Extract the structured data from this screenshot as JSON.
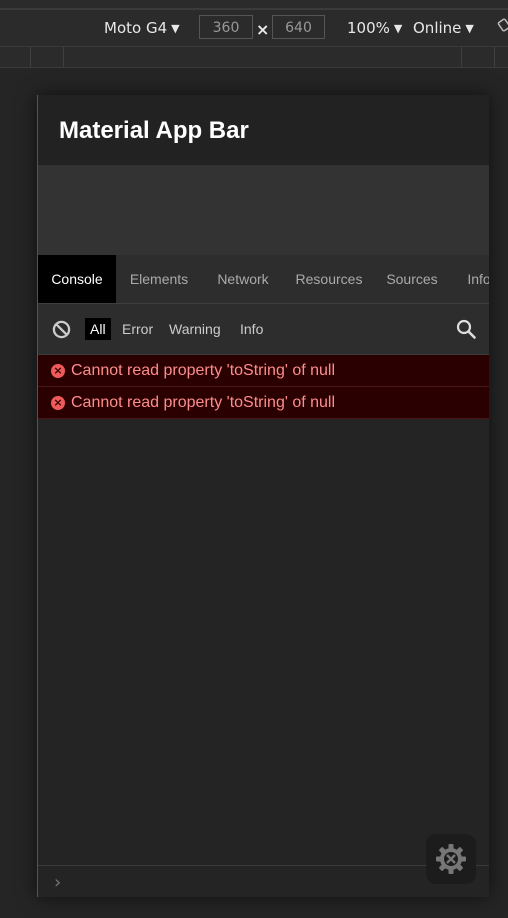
{
  "toolbar": {
    "device": "Moto G4",
    "width": "360",
    "times": "×",
    "height": "640",
    "zoom": "100%",
    "network": "Online"
  },
  "app": {
    "title": "Material App Bar"
  },
  "console": {
    "tabs": [
      {
        "label": "Console",
        "active": true
      },
      {
        "label": "Elements"
      },
      {
        "label": "Network"
      },
      {
        "label": "Resources"
      },
      {
        "label": "Sources"
      },
      {
        "label": "Info"
      }
    ],
    "filters": [
      {
        "label": "All",
        "active": true
      },
      {
        "label": "Error"
      },
      {
        "label": "Warning"
      },
      {
        "label": "Info"
      }
    ],
    "logs": [
      {
        "level": "error",
        "message": "Cannot read property 'toString' of null"
      },
      {
        "level": "error",
        "message": "Cannot read property 'toString' of null"
      }
    ],
    "prompt": "›"
  },
  "icons": {
    "clear": "block-icon",
    "search": "search-icon",
    "settings": "gear-icon",
    "error": "error-icon"
  },
  "colors": {
    "error_bg": "#2a0000",
    "error_text": "#ff8c8c",
    "error_icon": "#f05959"
  }
}
